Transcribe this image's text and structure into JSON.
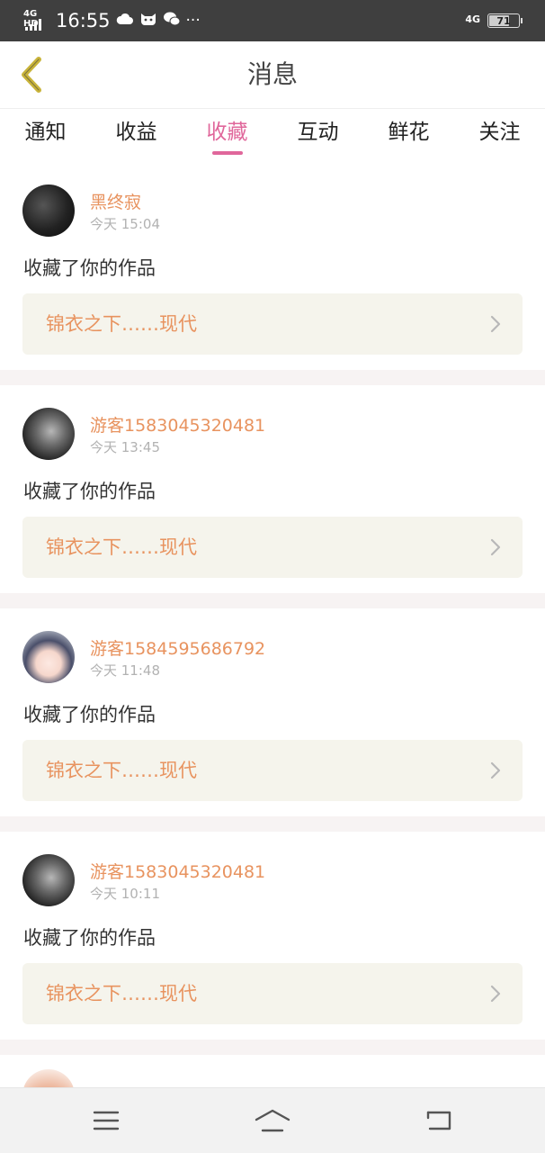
{
  "status_bar": {
    "network_type": "4G HD",
    "time": "16:55",
    "icons": [
      "cloud-icon",
      "cat-face-icon",
      "wechat-icon",
      "more-dots-icon"
    ],
    "more_dots": "···",
    "right_network": "4G",
    "battery": "71"
  },
  "header": {
    "title": "消息",
    "back_icon": "chevron-left-icon"
  },
  "tabs": [
    {
      "label": "通知"
    },
    {
      "label": "收益"
    },
    {
      "label": "收藏"
    },
    {
      "label": "互动"
    },
    {
      "label": "鲜花"
    },
    {
      "label": "关注"
    }
  ],
  "active_tab": "收藏",
  "messages": [
    {
      "username": "黑终寂",
      "time": "今天 15:04",
      "action": "收藏了你的作品",
      "work_title": "锦衣之下……现代"
    },
    {
      "username": "游客1583045320481",
      "time": "今天 13:45",
      "action": "收藏了你的作品",
      "work_title": "锦衣之下……现代"
    },
    {
      "username": "游客1584595686792",
      "time": "今天 11:48",
      "action": "收藏了你的作品",
      "work_title": "锦衣之下……现代"
    },
    {
      "username": "游客1583045320481",
      "time": "今天 10:11",
      "action": "收藏了你的作品",
      "work_title": "锦衣之下……现代"
    }
  ],
  "bottom_nav": {
    "icons": [
      "menu-icon",
      "home-icon",
      "back-icon"
    ]
  },
  "colors": {
    "accent_pink": "#e0679b",
    "username_orange": "#e8935f",
    "back_arrow": "#c9b43a",
    "card_bg": "#f5f4ec"
  }
}
